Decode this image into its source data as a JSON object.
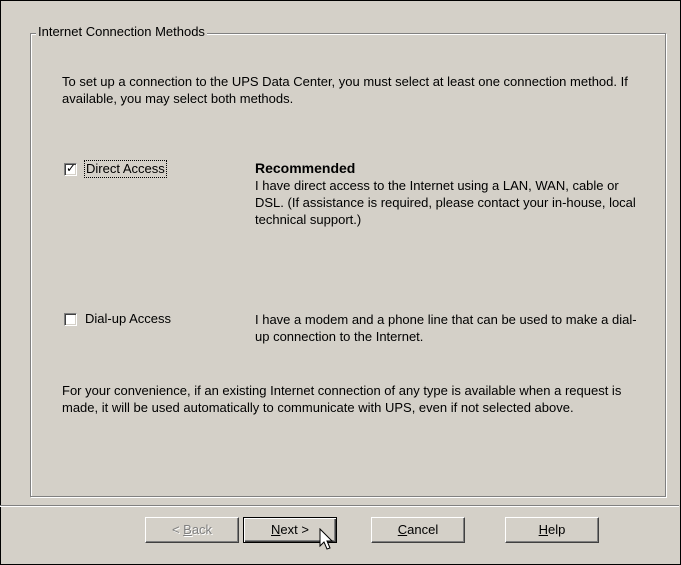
{
  "groupbox": {
    "title": "Internet Connection Methods"
  },
  "intro": "To set up a connection to the UPS Data Center, you must select at least one connection method. If available, you may select both methods.",
  "options": {
    "direct": {
      "label": "Direct Access",
      "checked": true,
      "heading": "Recommended",
      "description": "I have direct access to the Internet using a LAN, WAN, cable or DSL. (If assistance is required, please contact your in-house, local technical support.)"
    },
    "dialup": {
      "label": "Dial-up Access",
      "checked": false,
      "description": "I have a modem and a phone line that can be used to make a dial-up connection to the Internet."
    }
  },
  "footer_note": "For your convenience, if an existing Internet connection of any type is available when a request is made, it will be used automatically to communicate with UPS, even if not selected above.",
  "buttons": {
    "back": {
      "label": "< Back",
      "accel": "B",
      "enabled": false
    },
    "next": {
      "label": "Next >",
      "accel": "N",
      "enabled": true
    },
    "cancel": {
      "label": "Cancel",
      "accel": "C",
      "enabled": true
    },
    "help": {
      "label": "Help",
      "accel": "H",
      "enabled": true
    }
  },
  "colors": {
    "dialog_bg": "#d4d0c8",
    "disabled_text": "#808080"
  }
}
